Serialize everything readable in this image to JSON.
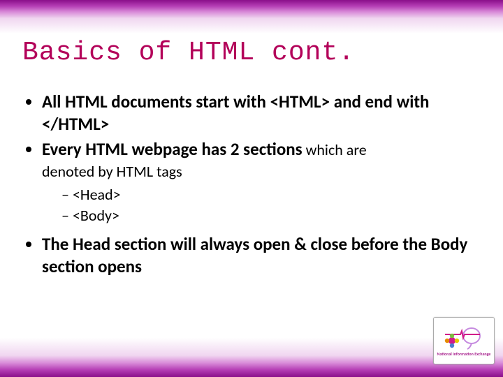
{
  "title": "Basics of HTML cont.",
  "bullets": {
    "b1": "All HTML documents start with <HTML> and end with </HTML>",
    "b2_bold": "Every HTML webpage has 2 sections",
    "b2_tail": " which are",
    "b2_line2": "denoted by HTML tags",
    "b2_sub1": "<Head>",
    "b2_sub2": "<Body>",
    "b3": "The Head section will always open & close before the Body section opens"
  },
  "logo": {
    "label": "National Information Exchange"
  }
}
